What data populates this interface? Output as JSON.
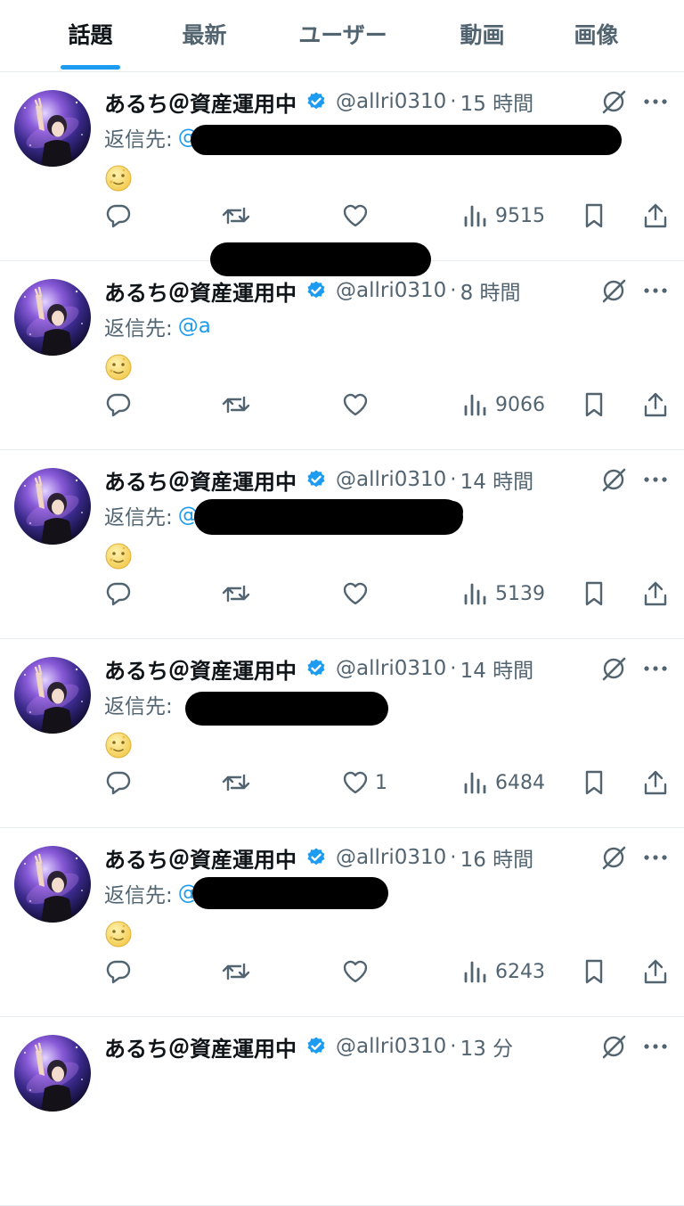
{
  "tabs": [
    {
      "label": "話題",
      "active": true
    },
    {
      "label": "最新",
      "active": false
    },
    {
      "label": "ユーザー",
      "active": false
    },
    {
      "label": "動画",
      "active": false
    },
    {
      "label": "画像",
      "active": false
    }
  ],
  "colors": {
    "accent": "#1d9bf0",
    "secondary_text": "#536471",
    "primary_text": "#0f1419",
    "redaction": "#000000"
  },
  "icons": {
    "verified": "verified-badge-icon",
    "grok": "grok-icon",
    "more": "more-icon",
    "emoji": "full-moon-face-emoji",
    "reply": "reply-icon",
    "retweet": "retweet-icon",
    "like": "like-icon",
    "views": "views-icon",
    "bookmark": "bookmark-icon",
    "share": "share-icon"
  },
  "posts": [
    {
      "name": "あるち＠資産運用中",
      "handle": "@allri0310",
      "separator": "·",
      "time": "15 時間",
      "reply_label": "返信先:",
      "reply_target": "@",
      "emoji": "🌝",
      "likes": "",
      "views": "9515",
      "redacted": true
    },
    {
      "name": "あるち＠資産運用中",
      "handle": "@allri0310",
      "separator": "·",
      "time": "8 時間",
      "reply_label": "返信先:",
      "reply_target": "@a",
      "emoji": "🌝",
      "likes": "",
      "views": "9066",
      "redacted": true
    },
    {
      "name": "あるち＠資産運用中",
      "handle": "@allri0310",
      "separator": "·",
      "time": "14 時間",
      "reply_label": "返信先:",
      "reply_target": "@T",
      "emoji": "🌝",
      "likes": "",
      "views": "5139",
      "redacted": true
    },
    {
      "name": "あるち＠資産運用中",
      "handle": "@allri0310",
      "separator": "·",
      "time": "14 時間",
      "reply_label": "返信先:",
      "reply_target": "",
      "emoji": "🌝",
      "likes": "1",
      "views": "6484",
      "redacted": true
    },
    {
      "name": "あるち＠資産運用中",
      "handle": "@allri0310",
      "separator": "·",
      "time": "16 時間",
      "reply_label": "返信先:",
      "reply_target": "@",
      "emoji": "🌝",
      "likes": "",
      "views": "6243",
      "redacted": true
    },
    {
      "name": "あるち＠資産運用中",
      "handle": "@allri0310",
      "separator": "·",
      "time": "13 分",
      "reply_label": "",
      "reply_target": "",
      "emoji": "",
      "likes": "",
      "views": "",
      "redacted": false
    }
  ]
}
